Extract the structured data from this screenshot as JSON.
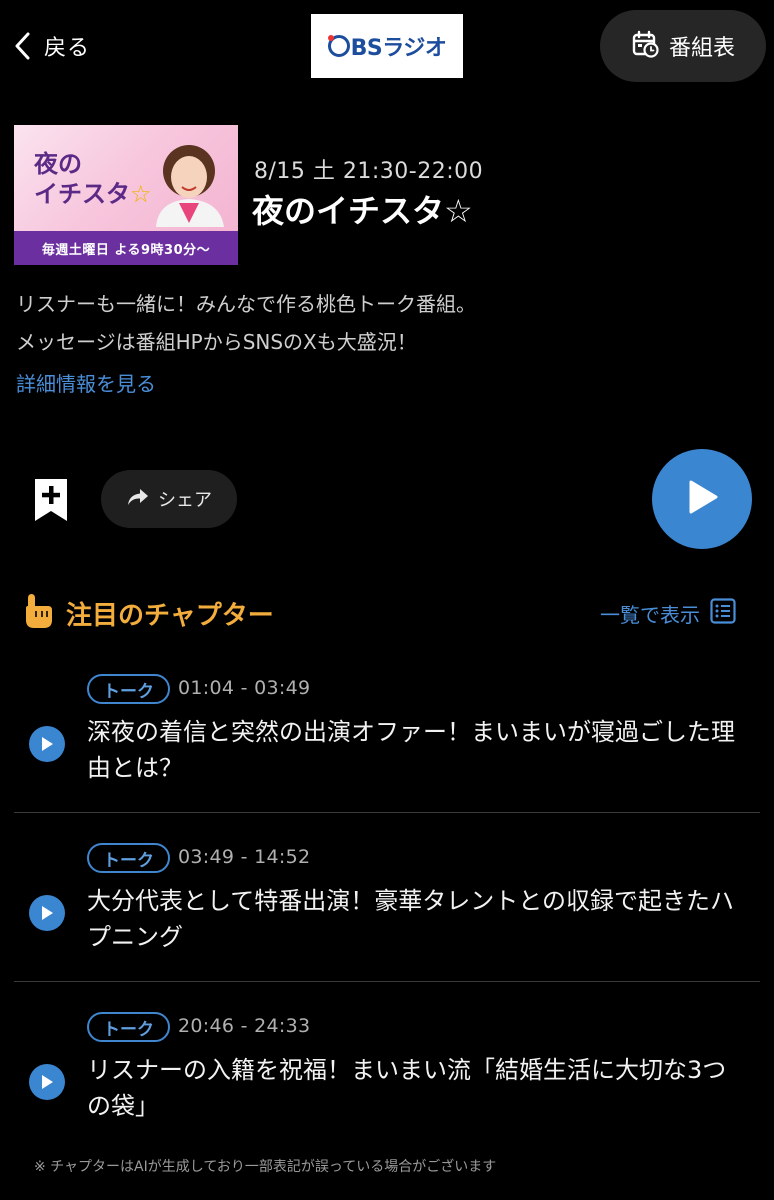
{
  "header": {
    "back_label": "戻る",
    "station_logo_text": "BSラジオ",
    "station_logo_alt": "OBSラジオ",
    "schedule_label": "番組表"
  },
  "program": {
    "thumbnail": {
      "title_line1": "夜の",
      "title_line2": "イチスタ",
      "title_star": "☆",
      "banner": "毎週土曜日 よる9時30分～"
    },
    "airtime": "8/15 土 21:30-22:00",
    "title": "夜のイチスタ☆",
    "description_line1": "リスナーも一緒に！みんなで作る桃色トーク番組。",
    "description_line2": "メッセージは番組HPからSNSのXも大盛況！",
    "details_link": "詳細情報を見る"
  },
  "actions": {
    "share_label": "シェア"
  },
  "chapters": {
    "heading": "注目のチャプター",
    "list_view_label": "一覧で表示",
    "items": [
      {
        "tag": "トーク",
        "range": "01:04 - 03:49",
        "title": "深夜の着信と突然の出演オファー！まいまいが寝過ごした理由とは？"
      },
      {
        "tag": "トーク",
        "range": "03:49 - 14:52",
        "title": "大分代表として特番出演！豪華タレントとの収録で起きたハプニング"
      },
      {
        "tag": "トーク",
        "range": "20:46 - 24:33",
        "title": "リスナーの入籍を祝福！まいまい流「結婚生活に大切な3つの袋」"
      }
    ]
  },
  "footnote": "※ チャプターはAIが生成しており一部表記が誤っている場合がございます",
  "colors": {
    "accent_blue": "#3b86d1",
    "link_blue": "#4a8ed8",
    "chapter_heading_orange": "#f3ad3d"
  },
  "icons": {
    "back": "chevron-left-icon",
    "schedule": "calendar-clock-icon",
    "bookmark": "bookmark-plus-icon",
    "share": "share-arrow-icon",
    "play": "play-icon",
    "chapter_heading": "pointing-hand-icon",
    "list_view": "list-icon"
  }
}
